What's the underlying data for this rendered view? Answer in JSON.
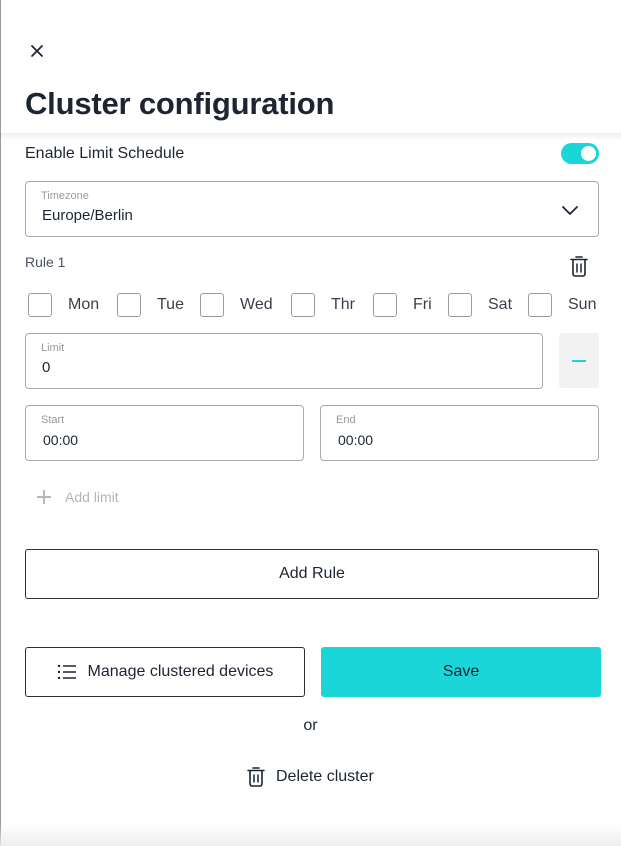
{
  "header": {
    "title": "Cluster configuration",
    "close_icon": "close-icon"
  },
  "schedule": {
    "enable_label": "Enable Limit Schedule",
    "enabled": true,
    "accent_color": "#1ad6d9"
  },
  "timezone": {
    "label": "Timezone",
    "value": "Europe/Berlin"
  },
  "rule": {
    "label": "Rule 1",
    "days": [
      {
        "label": "Mon",
        "checked": false
      },
      {
        "label": "Tue",
        "checked": false
      },
      {
        "label": "Wed",
        "checked": false
      },
      {
        "label": "Thr",
        "checked": false
      },
      {
        "label": "Fri",
        "checked": false
      },
      {
        "label": "Sat",
        "checked": false
      },
      {
        "label": "Sun",
        "checked": false
      }
    ],
    "limit_label": "Limit",
    "limit_value": "0",
    "start_label": "Start",
    "start_value": "00:00",
    "end_label": "End",
    "end_value": "00:00",
    "add_limit_label": "Add limit"
  },
  "actions": {
    "add_rule_label": "Add Rule",
    "manage_label": "Manage clustered devices",
    "save_label": "Save",
    "or_label": "or",
    "delete_label": "Delete cluster"
  }
}
